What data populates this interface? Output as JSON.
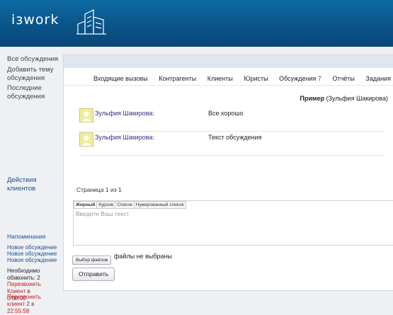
{
  "header": {
    "logo_text": "iзwork"
  },
  "sidebar": {
    "all_discussions": "Все обсуждения",
    "add_topic": "Добавить тему обсуждения",
    "recent": "Последние обсуждения",
    "client_actions": "Действия клиентов",
    "reminders_title": "Напоминания",
    "reminders": [
      "Новое обсуждение",
      "Новое обсуждение",
      "Новое обсуждение"
    ],
    "need_call": "Необходимо обзвонить: 2",
    "callbacks": [
      "Перезвонить Клиент в 0:00:00",
      "Перезвонить клиент 2 в 22:55:58"
    ]
  },
  "tabs": [
    {
      "label": "Входящие вызовы",
      "count": ""
    },
    {
      "label": "Контрагенты",
      "count": ""
    },
    {
      "label": "Клиенты",
      "count": ""
    },
    {
      "label": "Юристы",
      "count": ""
    },
    {
      "label": "Обсуждения",
      "count": "7"
    },
    {
      "label": "Отчёты",
      "count": ""
    },
    {
      "label": "Задания",
      "count": ""
    }
  ],
  "topic": {
    "title": "Пример",
    "author": "(Зульфия Шакирова)"
  },
  "messages": [
    {
      "author": "Зульфия Шакирова:",
      "text": "Все хорошо"
    },
    {
      "author": "Зульфия Шакирова:",
      "text": "Текст обсуждения"
    }
  ],
  "pager": "Страница 1 из 1",
  "editor": {
    "tabs": [
      "Жирный",
      "Курсив",
      "Список",
      "Нумерованный список"
    ],
    "placeholder": "Введите Ваш текст"
  },
  "file": {
    "button": "Выбор файлов",
    "status": "файлы не выбраны"
  },
  "send_button": "Отправить"
}
